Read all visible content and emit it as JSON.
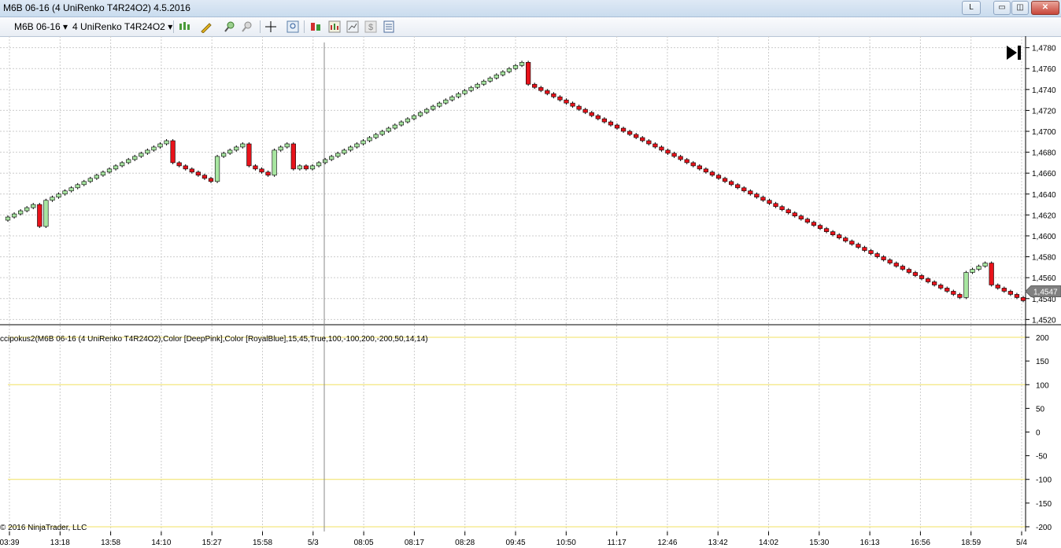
{
  "window": {
    "title": "M6B 06-16 (4 UniRenko T4R24O2)  4.5.2016",
    "btn_l": "L",
    "btn_min": "▭",
    "btn_max": "◫",
    "btn_close": "✕"
  },
  "toolbar": {
    "instrument": "M6B 06-16",
    "period": "4 UniRenko T4R24O2",
    "dropdown": "▾"
  },
  "chart": {
    "price_axis": [
      "1,4780",
      "1,4760",
      "1,4740",
      "1,4720",
      "1,4700",
      "1,4680",
      "1,4660",
      "1,4640",
      "1,4620",
      "1,4600",
      "1,4580",
      "1,4560",
      "1,4540",
      "1,4520"
    ],
    "current_price": "1,4547",
    "indicator_label": "ccipokus2(M6B 06-16 (4 UniRenko T4R24O2),Color [DeepPink],Color [RoyalBlue],15,45,True,100,-100,200,-200,50,14,14)",
    "indicator_axis": [
      "200",
      "150",
      "100",
      "50",
      "0",
      "-50",
      "-100",
      "-150",
      "-200"
    ],
    "time_axis": [
      "03:39",
      "13:18",
      "13:58",
      "14:10",
      "15:27",
      "15:58",
      "5/3",
      "08:05",
      "08:17",
      "08:28",
      "09:45",
      "10:50",
      "11:17",
      "12:46",
      "13:42",
      "14:02",
      "15:30",
      "16:13",
      "16:56",
      "18:59",
      "5/4"
    ],
    "copyright": "© 2016 NinjaTrader, LLC",
    "colors": {
      "up": "#a8e6a1",
      "down": "#e8131b",
      "wick": "#000000",
      "level_line": "#f0e060",
      "grid": "#cccccc"
    },
    "chart_data": {
      "type": "candlestick",
      "series": [
        {
          "name": "M6B 06-16",
          "close": [
            1.4618,
            1.4621,
            1.4624,
            1.4627,
            1.463,
            1.4609,
            1.4634,
            1.4637,
            1.464,
            1.4643,
            1.4646,
            1.4649,
            1.4652,
            1.4655,
            1.4658,
            1.4661,
            1.4664,
            1.4667,
            1.467,
            1.4673,
            1.4676,
            1.4679,
            1.4682,
            1.4685,
            1.4688,
            1.4691,
            1.467,
            1.4667,
            1.4664,
            1.4661,
            1.4658,
            1.4655,
            1.4652,
            1.4676,
            1.4679,
            1.4682,
            1.4685,
            1.4688,
            1.4667,
            1.4664,
            1.4661,
            1.4658,
            1.4682,
            1.4685,
            1.4688,
            1.4664,
            1.4667,
            1.4664,
            1.4667,
            1.467,
            1.4673,
            1.4676,
            1.4679,
            1.4682,
            1.4685,
            1.4688,
            1.4691,
            1.4694,
            1.4697,
            1.47,
            1.4703,
            1.4706,
            1.4709,
            1.4712,
            1.4715,
            1.4718,
            1.4721,
            1.4724,
            1.4727,
            1.473,
            1.4733,
            1.4736,
            1.4739,
            1.4742,
            1.4745,
            1.4748,
            1.4751,
            1.4754,
            1.4757,
            1.476,
            1.4763,
            1.4766,
            1.4745,
            1.4742,
            1.4739,
            1.4736,
            1.4733,
            1.473,
            1.4727,
            1.4724,
            1.4721,
            1.4718,
            1.4715,
            1.4712,
            1.4709,
            1.4706,
            1.4703,
            1.47,
            1.4697,
            1.4694,
            1.4691,
            1.4688,
            1.4685,
            1.4682,
            1.4679,
            1.4676,
            1.4673,
            1.467,
            1.4667,
            1.4664,
            1.4661,
            1.4658,
            1.4655,
            1.4652,
            1.4649,
            1.4646,
            1.4643,
            1.464,
            1.4637,
            1.4634,
            1.4631,
            1.4628,
            1.4625,
            1.4622,
            1.4619,
            1.4616,
            1.4613,
            1.461,
            1.4607,
            1.4604,
            1.4601,
            1.4598,
            1.4595,
            1.4592,
            1.4589,
            1.4586,
            1.4583,
            1.458,
            1.4577,
            1.4574,
            1.4571,
            1.4568,
            1.4565,
            1.4562,
            1.4559,
            1.4556,
            1.4553,
            1.455,
            1.4547,
            1.4544,
            1.4541,
            1.4565,
            1.4568,
            1.4571,
            1.4574,
            1.4553,
            1.455,
            1.4547,
            1.4544,
            1.4541,
            1.4538
          ]
        }
      ],
      "ylim": [
        1.4515,
        1.4785
      ],
      "indicator": {
        "name": "ccipokus2",
        "levels": [
          200,
          100,
          -100,
          -200
        ],
        "ylim": [
          -210,
          215
        ]
      }
    }
  }
}
